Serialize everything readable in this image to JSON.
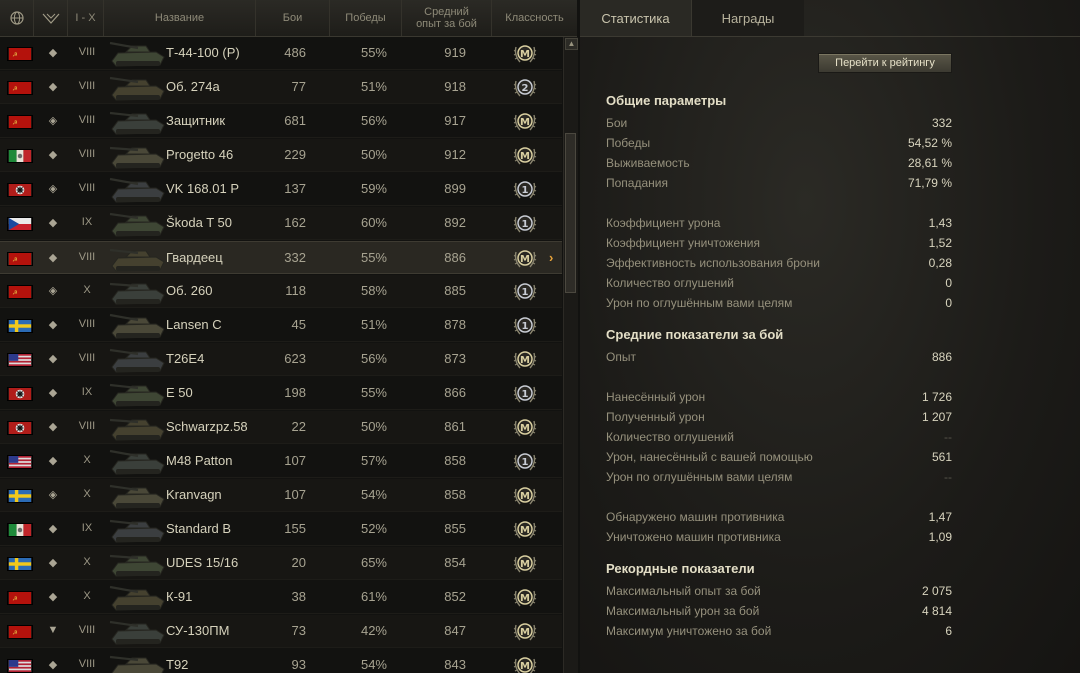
{
  "header": {
    "col_tier": "I - X",
    "col_name": "Название",
    "col_battles": "Бои",
    "col_wins": "Победы",
    "col_xp_line1": "Средний",
    "col_xp_line2": "опыт за бой",
    "col_class": "Классность"
  },
  "rows": [
    {
      "flag": "ussr",
      "type": "◆",
      "tier": "VIII",
      "name": "Т-44-100 (Р)",
      "battles": "486",
      "wins": "55%",
      "xp": "919",
      "badge": "M"
    },
    {
      "flag": "ussr",
      "type": "◆",
      "tier": "VIII",
      "name": "Об. 274а",
      "battles": "77",
      "wins": "51%",
      "xp": "918",
      "badge": "2"
    },
    {
      "flag": "ussr",
      "type": "◈",
      "tier": "VIII",
      "name": "Защитник",
      "battles": "681",
      "wins": "56%",
      "xp": "917",
      "badge": "M"
    },
    {
      "flag": "italy",
      "type": "◆",
      "tier": "VIII",
      "name": "Progetto 46",
      "battles": "229",
      "wins": "50%",
      "xp": "912",
      "badge": "M"
    },
    {
      "flag": "germany",
      "type": "◈",
      "tier": "VIII",
      "name": "VK 168.01 P",
      "battles": "137",
      "wins": "59%",
      "xp": "899",
      "badge": "1"
    },
    {
      "flag": "czech",
      "type": "◆",
      "tier": "IX",
      "name": "Škoda T 50",
      "battles": "162",
      "wins": "60%",
      "xp": "892",
      "badge": "1"
    },
    {
      "flag": "ussr",
      "type": "◆",
      "tier": "VIII",
      "name": "Гвардеец",
      "battles": "332",
      "wins": "55%",
      "xp": "886",
      "badge": "M",
      "selected": true
    },
    {
      "flag": "ussr",
      "type": "◈",
      "tier": "X",
      "name": "Об. 260",
      "battles": "118",
      "wins": "58%",
      "xp": "885",
      "badge": "1"
    },
    {
      "flag": "sweden",
      "type": "◆",
      "tier": "VIII",
      "name": "Lansen C",
      "battles": "45",
      "wins": "51%",
      "xp": "878",
      "badge": "1"
    },
    {
      "flag": "usa",
      "type": "◆",
      "tier": "VIII",
      "name": "T26E4",
      "battles": "623",
      "wins": "56%",
      "xp": "873",
      "badge": "M"
    },
    {
      "flag": "germany",
      "type": "◆",
      "tier": "IX",
      "name": "E 50",
      "battles": "198",
      "wins": "55%",
      "xp": "866",
      "badge": "1"
    },
    {
      "flag": "germany",
      "type": "◆",
      "tier": "VIII",
      "name": "Schwarzpz.58",
      "battles": "22",
      "wins": "50%",
      "xp": "861",
      "badge": "M"
    },
    {
      "flag": "usa",
      "type": "◆",
      "tier": "X",
      "name": "M48 Patton",
      "battles": "107",
      "wins": "57%",
      "xp": "858",
      "badge": "1"
    },
    {
      "flag": "sweden",
      "type": "◈",
      "tier": "X",
      "name": "Kranvagn",
      "battles": "107",
      "wins": "54%",
      "xp": "858",
      "badge": "M"
    },
    {
      "flag": "italy",
      "type": "◆",
      "tier": "IX",
      "name": "Standard B",
      "battles": "155",
      "wins": "52%",
      "xp": "855",
      "badge": "M"
    },
    {
      "flag": "sweden",
      "type": "◆",
      "tier": "X",
      "name": "UDES 15/16",
      "battles": "20",
      "wins": "65%",
      "xp": "854",
      "badge": "M"
    },
    {
      "flag": "ussr",
      "type": "◆",
      "tier": "X",
      "name": "К-91",
      "battles": "38",
      "wins": "61%",
      "xp": "852",
      "badge": "M"
    },
    {
      "flag": "ussr",
      "type": "▼",
      "tier": "VIII",
      "name": "СУ-130ПМ",
      "battles": "73",
      "wins": "42%",
      "xp": "847",
      "badge": "M"
    },
    {
      "flag": "usa",
      "type": "◆",
      "tier": "VIII",
      "name": "T92",
      "battles": "93",
      "wins": "54%",
      "xp": "843",
      "badge": "M"
    }
  ],
  "tabs": {
    "stats": "Статистика",
    "awards": "Награды"
  },
  "rating_button": "Перейти к рейтингу",
  "stats": {
    "general": {
      "title": "Общие параметры",
      "items": [
        {
          "label": "Бои",
          "value": "332"
        },
        {
          "label": "Победы",
          "value": "54,52 %"
        },
        {
          "label": "Выживаемость",
          "value": "28,61 %"
        },
        {
          "label": "Попадания",
          "value": "71,79 %"
        }
      ],
      "items2": [
        {
          "label": "Коэффициент урона",
          "value": "1,43"
        },
        {
          "label": "Коэффициент уничтожения",
          "value": "1,52"
        },
        {
          "label": "Эффективность использования брони",
          "value": "0,28"
        },
        {
          "label": "Количество оглушений",
          "value": "0"
        },
        {
          "label": "Урон по оглушённым вами целям",
          "value": "0"
        }
      ]
    },
    "average": {
      "title": "Средние показатели за бой",
      "items": [
        {
          "label": "Опыт",
          "value": "886"
        }
      ],
      "items2": [
        {
          "label": "Нанесённый урон",
          "value": "1 726"
        },
        {
          "label": "Полученный урон",
          "value": "1 207"
        },
        {
          "label": "Количество оглушений",
          "value": "--"
        },
        {
          "label": "Урон, нанесённый с вашей помощью",
          "value": "561"
        },
        {
          "label": "Урон по оглушённым вами целям",
          "value": "--"
        }
      ],
      "items3": [
        {
          "label": "Обнаружено машин противника",
          "value": "1,47"
        },
        {
          "label": "Уничтожено машин противника",
          "value": "1,09"
        }
      ]
    },
    "records": {
      "title": "Рекордные показатели",
      "items": [
        {
          "label": "Максимальный опыт за бой",
          "value": "2 075"
        },
        {
          "label": "Максимальный урон за бой",
          "value": "4 814"
        },
        {
          "label": "Максимум уничтожено за бой",
          "value": "6"
        }
      ]
    }
  },
  "colors": {
    "accent": "#e8a33a",
    "text": "#d6d2bc",
    "muted": "#96917d"
  }
}
